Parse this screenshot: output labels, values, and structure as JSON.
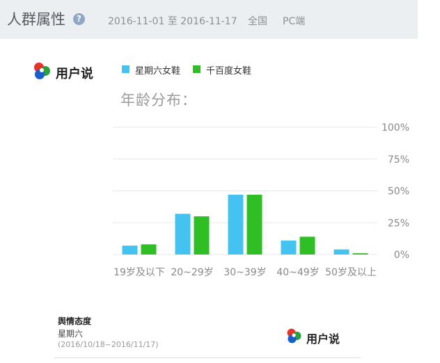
{
  "header": {
    "title": "人群属性",
    "date_range": "2016-11-01 至 2016-11-17",
    "region": "全国",
    "platform": "PC端"
  },
  "logo": {
    "text": "用户说"
  },
  "legend": {
    "series_a": "星期六女鞋",
    "series_b": "千百度女鞋"
  },
  "colors": {
    "series_a": "#45c3f0",
    "series_b": "#2fbf25",
    "grid": "#e8e8e8",
    "axis_text": "#888888"
  },
  "chart_data": {
    "type": "bar",
    "title": "年龄分布：",
    "categories": [
      "19岁及以下",
      "20~29岁",
      "30~39岁",
      "40~49岁",
      "50岁及以上"
    ],
    "series": [
      {
        "name": "星期六女鞋",
        "values": [
          7,
          32,
          47,
          11,
          4
        ]
      },
      {
        "name": "千百度女鞋",
        "values": [
          8,
          30,
          47,
          14,
          1
        ]
      }
    ],
    "yticks": [
      "100%",
      "75%",
      "50%",
      "25%",
      "0%"
    ],
    "ylim": [
      0,
      100
    ],
    "grid": true,
    "legend_position": "top"
  },
  "sentiment": {
    "title": "舆情态度",
    "subject": "星期六",
    "range": "(2016/10/18~2016/11/17)"
  }
}
